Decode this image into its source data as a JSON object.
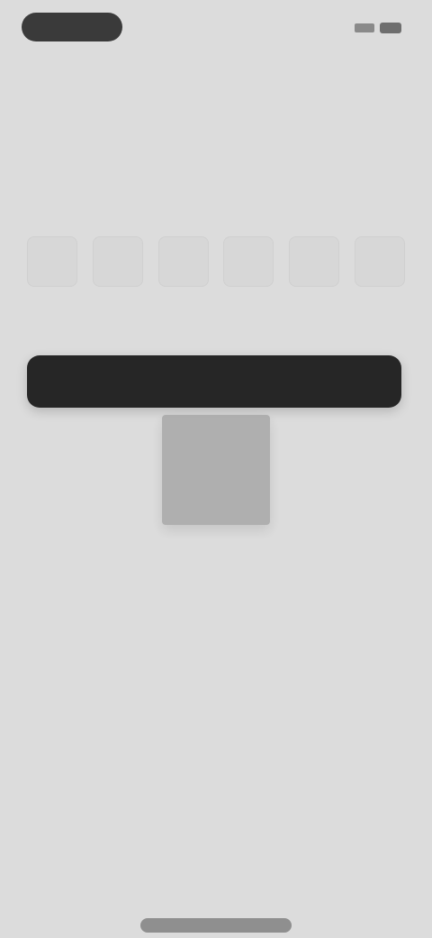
{
  "status_bar": {
    "left_pill_text": "",
    "signal_icon": "signal-icon",
    "battery_icon": "battery-icon"
  },
  "screen": {
    "title": "",
    "subtitle_line_1": "",
    "subtitle_line_2": ""
  },
  "code_input": {
    "digits": [
      "",
      "",
      "",
      "",
      "",
      ""
    ]
  },
  "timer_text": "",
  "primary_button_label": "",
  "colors": {
    "background": "#dcdcdc",
    "button": "#262626",
    "title": "#505050"
  }
}
